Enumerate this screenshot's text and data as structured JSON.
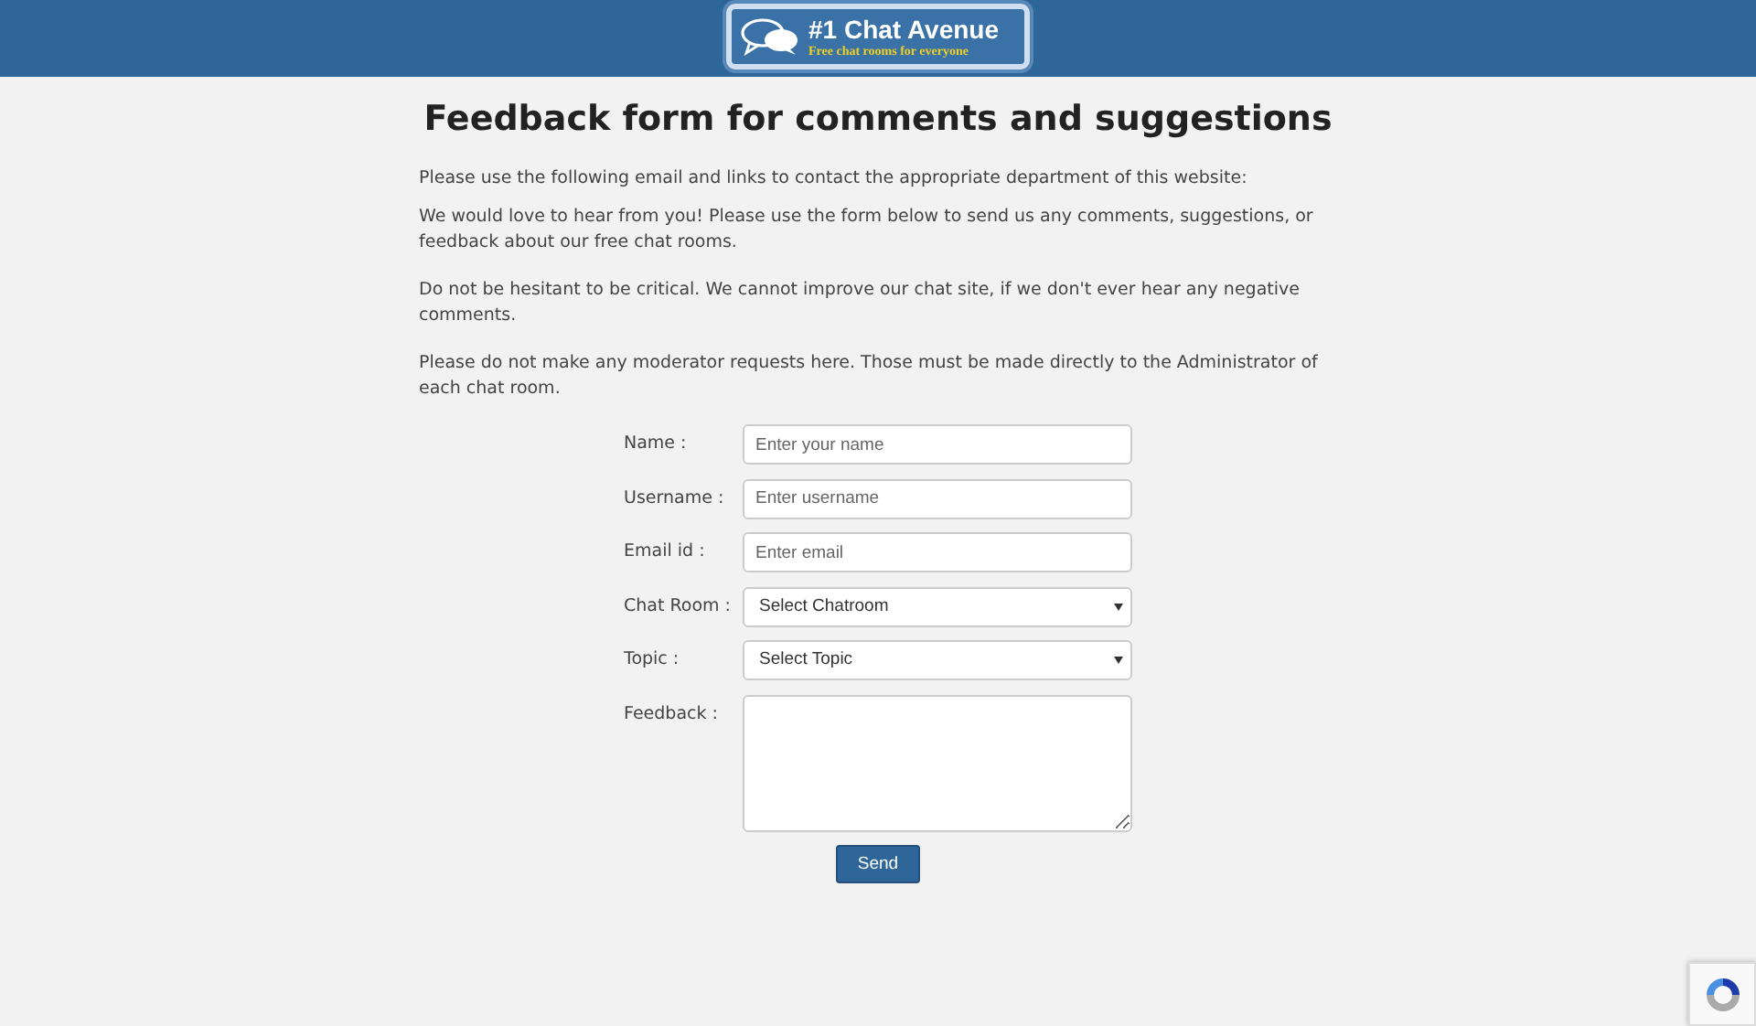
{
  "header": {
    "logo_title": "#1 Chat Avenue",
    "logo_tagline": "Free chat rooms for everyone"
  },
  "title": "Feedback form for comments and suggestions",
  "paragraphs": [
    "Please use the following email and links to contact the appropriate department of this website:",
    "We would love to hear from you! Please use the form below to send us any comments, suggestions, or feedback about our free chat rooms.",
    "Do not be hesitant to be critical. We cannot improve our chat site, if we don't ever hear any negative comments.",
    "Please do not make any moderator requests here. Those must be made directly to the Administrator of each chat room."
  ],
  "form": {
    "fields": [
      {
        "kind": "text",
        "label": "Name :",
        "placeholder": "Enter your name"
      },
      {
        "kind": "text",
        "label": "Username :",
        "placeholder": "Enter username"
      },
      {
        "kind": "text",
        "label": "Email id :",
        "placeholder": "Enter email"
      },
      {
        "kind": "select",
        "label": "Chat Room :",
        "value": "Select Chatroom"
      },
      {
        "kind": "select",
        "label": "Topic :",
        "value": "Select Topic"
      },
      {
        "kind": "textarea",
        "label": "Feedback :"
      }
    ],
    "submit": "Send"
  }
}
